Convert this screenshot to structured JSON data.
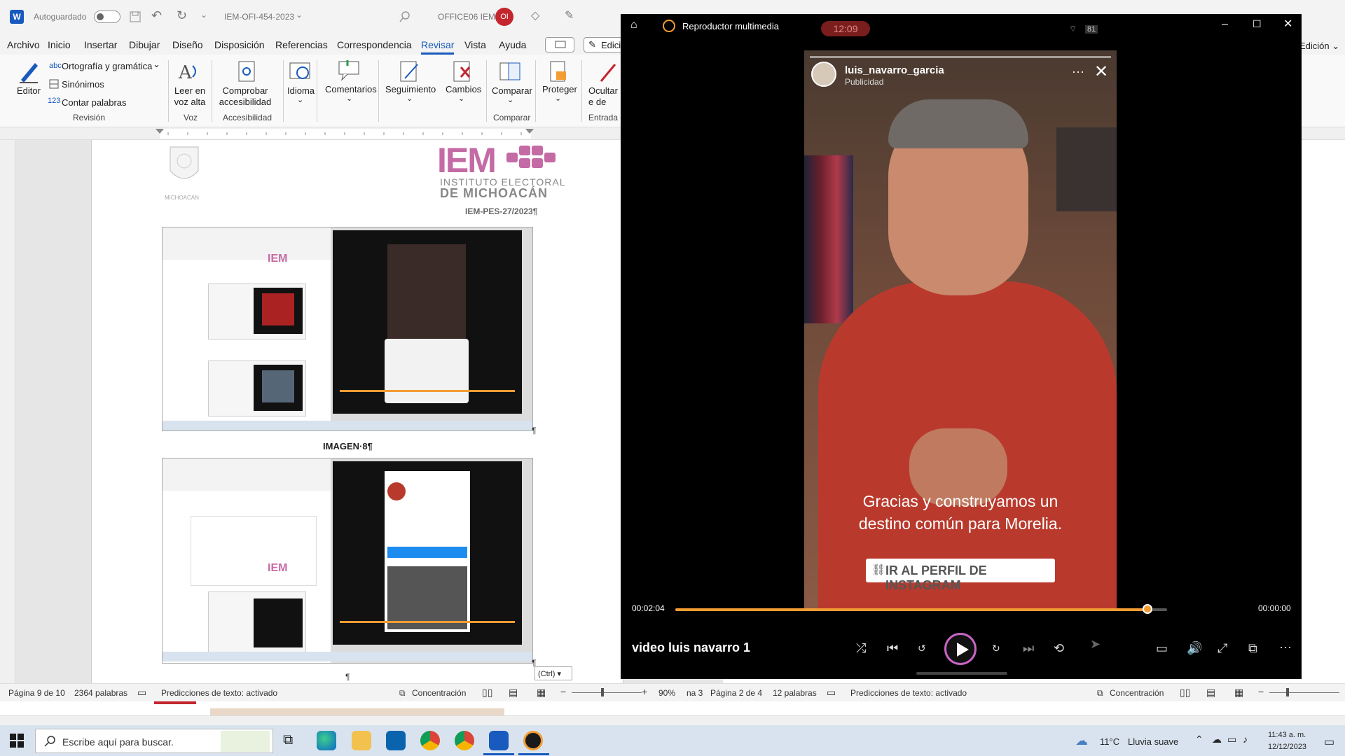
{
  "word": {
    "logo_letter": "W",
    "autosave_label": "Autoguardado",
    "doc_title": "IEM-OFI-454-2023",
    "doc_title_chevron": "⌄",
    "account": "OFFICE06 IEM",
    "avatar_initials": "OI",
    "menu": [
      "Archivo",
      "Inicio",
      "Insertar",
      "Dibujar",
      "Diseño",
      "Disposición",
      "Referencias",
      "Correspondencia",
      "Revisar",
      "Vista",
      "Ayuda"
    ],
    "active_menu": "Revisar",
    "edit_mode": "Edición",
    "edit_mode_right": "Edición ⌄",
    "ribbon": {
      "editor": "Editor",
      "ortografia": "Ortografía y gramática",
      "sinonimos": "Sinónimos",
      "contar": "Contar palabras",
      "group_revision": "Revisión",
      "leer": "Leer en voz alta",
      "group_voz": "Voz",
      "comprobar": "Comprobar accesibilidad",
      "group_acc": "Accesibilidad",
      "idioma": "Idioma",
      "comentarios": "Comentarios",
      "seguimiento": "Seguimiento",
      "cambios": "Cambios",
      "comparar": "Comparar",
      "group_comparar": "Comparar",
      "proteger": "Proteger",
      "ocultar": "Ocultar e de láp",
      "group_entrada": "Entrada d"
    },
    "doc": {
      "header_state": "MICHOACÁN",
      "iem_big": "IEM",
      "iem_line1": "INSTITUTO ELECTORAL",
      "iem_line2": "DE MICHOACÁN",
      "ref": "IEM-PES-27/2023¶",
      "img8": "IMAGEN·8¶",
      "para_mark": "¶",
      "ctrl_tag": "(Ctrl) ▾"
    },
    "status": {
      "page": "Página 9 de 10",
      "words": "2364 palabras",
      "predictions": "Predicciones de texto: activado",
      "focus": "Concentración",
      "zoom": "90%",
      "page2": "Página 2 de 4",
      "words2": "12 palabras",
      "predictions2": "Predicciones de texto: activado",
      "focus2": "Concentración",
      "partial": "na 3"
    }
  },
  "player": {
    "title": "Reproductor multimedia",
    "clock_overlay": "12:09",
    "battery": "81",
    "ig_user": "luis_navarro_garcia",
    "ig_sub": "Publicidad",
    "caption_line1": "Gracias y construyamos un",
    "caption_line2": "destino común para Morelia.",
    "cta": "IR AL PERFIL DE INSTAGRAM",
    "time_elapsed": "00:02:04",
    "time_total": "00:00:00",
    "progress": 0.96,
    "video_name": "video luis navarro 1"
  },
  "taskbar": {
    "search_placeholder": "Escribe aquí para buscar.",
    "weather_temp": "11°C",
    "weather_desc": "Lluvia suave",
    "time": "11:43 a. m.",
    "date": "12/12/2023"
  },
  "colors": {
    "word_blue": "#185abd",
    "iem_pink": "#c46aa5",
    "player_accent": "#f39c34",
    "shirt_red": "#b93a2d"
  }
}
